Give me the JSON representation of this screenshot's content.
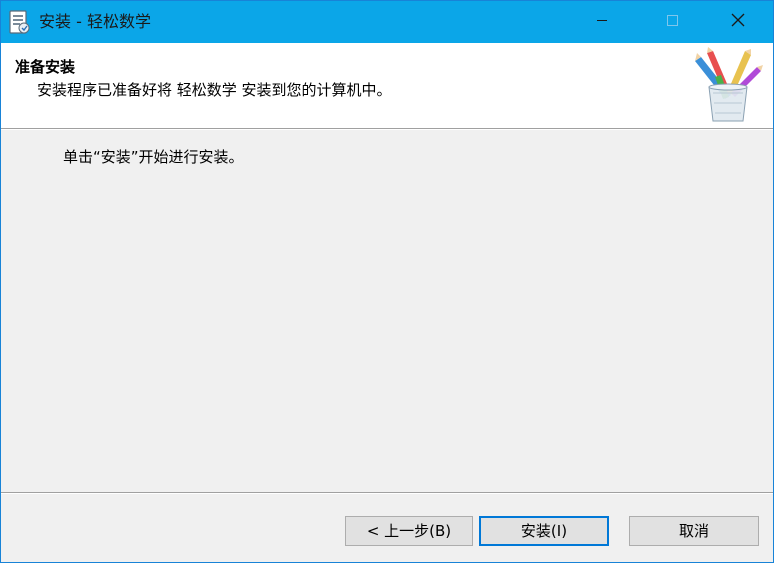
{
  "window": {
    "title": "安装 - 轻松数学",
    "accent_color": "#0ba6e8"
  },
  "title_bar": {
    "icon": "installer-app-icon",
    "buttons": [
      {
        "name": "minimize",
        "icon": "minimize-icon"
      },
      {
        "name": "maximize",
        "icon": "maximize-icon",
        "disabled": true
      },
      {
        "name": "close",
        "icon": "close-icon"
      }
    ]
  },
  "header": {
    "title": "准备安装",
    "subtitle": "安装程序已准备好将 轻松数学 安装到您的计算机中。",
    "image": "pencils-in-cup-icon"
  },
  "body": {
    "instruction": "单击“安装”开始进行安装。"
  },
  "footer": {
    "back_label": "< 上一步(B)",
    "install_label": "安装(I)",
    "cancel_label": "取消"
  }
}
